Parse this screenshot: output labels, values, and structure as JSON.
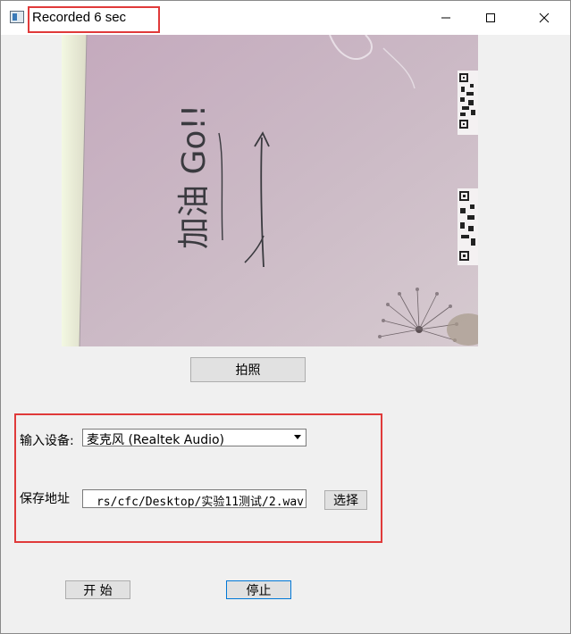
{
  "window": {
    "title": "Recorded 6 sec",
    "minimize_label": "",
    "maximize_label": "",
    "close_label": ""
  },
  "camera": {
    "icon": "camera-preview",
    "handwriting": "加油 Go!!",
    "colors": {
      "paper": "#c7b3c1",
      "edge": "#eaf2d8"
    }
  },
  "capture_button": {
    "label": "拍照"
  },
  "device": {
    "label": "输入设备:",
    "selected": "麦克风 (Realtek Audio)"
  },
  "save": {
    "label": "保存地址",
    "path": "rs/cfc/Desktop/实验11测试/2.wav",
    "browse_label": "选择"
  },
  "controls": {
    "start_label": "开 始",
    "stop_label": "停止"
  },
  "accent": {
    "annotation": "#e03a3a",
    "focus": "#0078d7"
  }
}
